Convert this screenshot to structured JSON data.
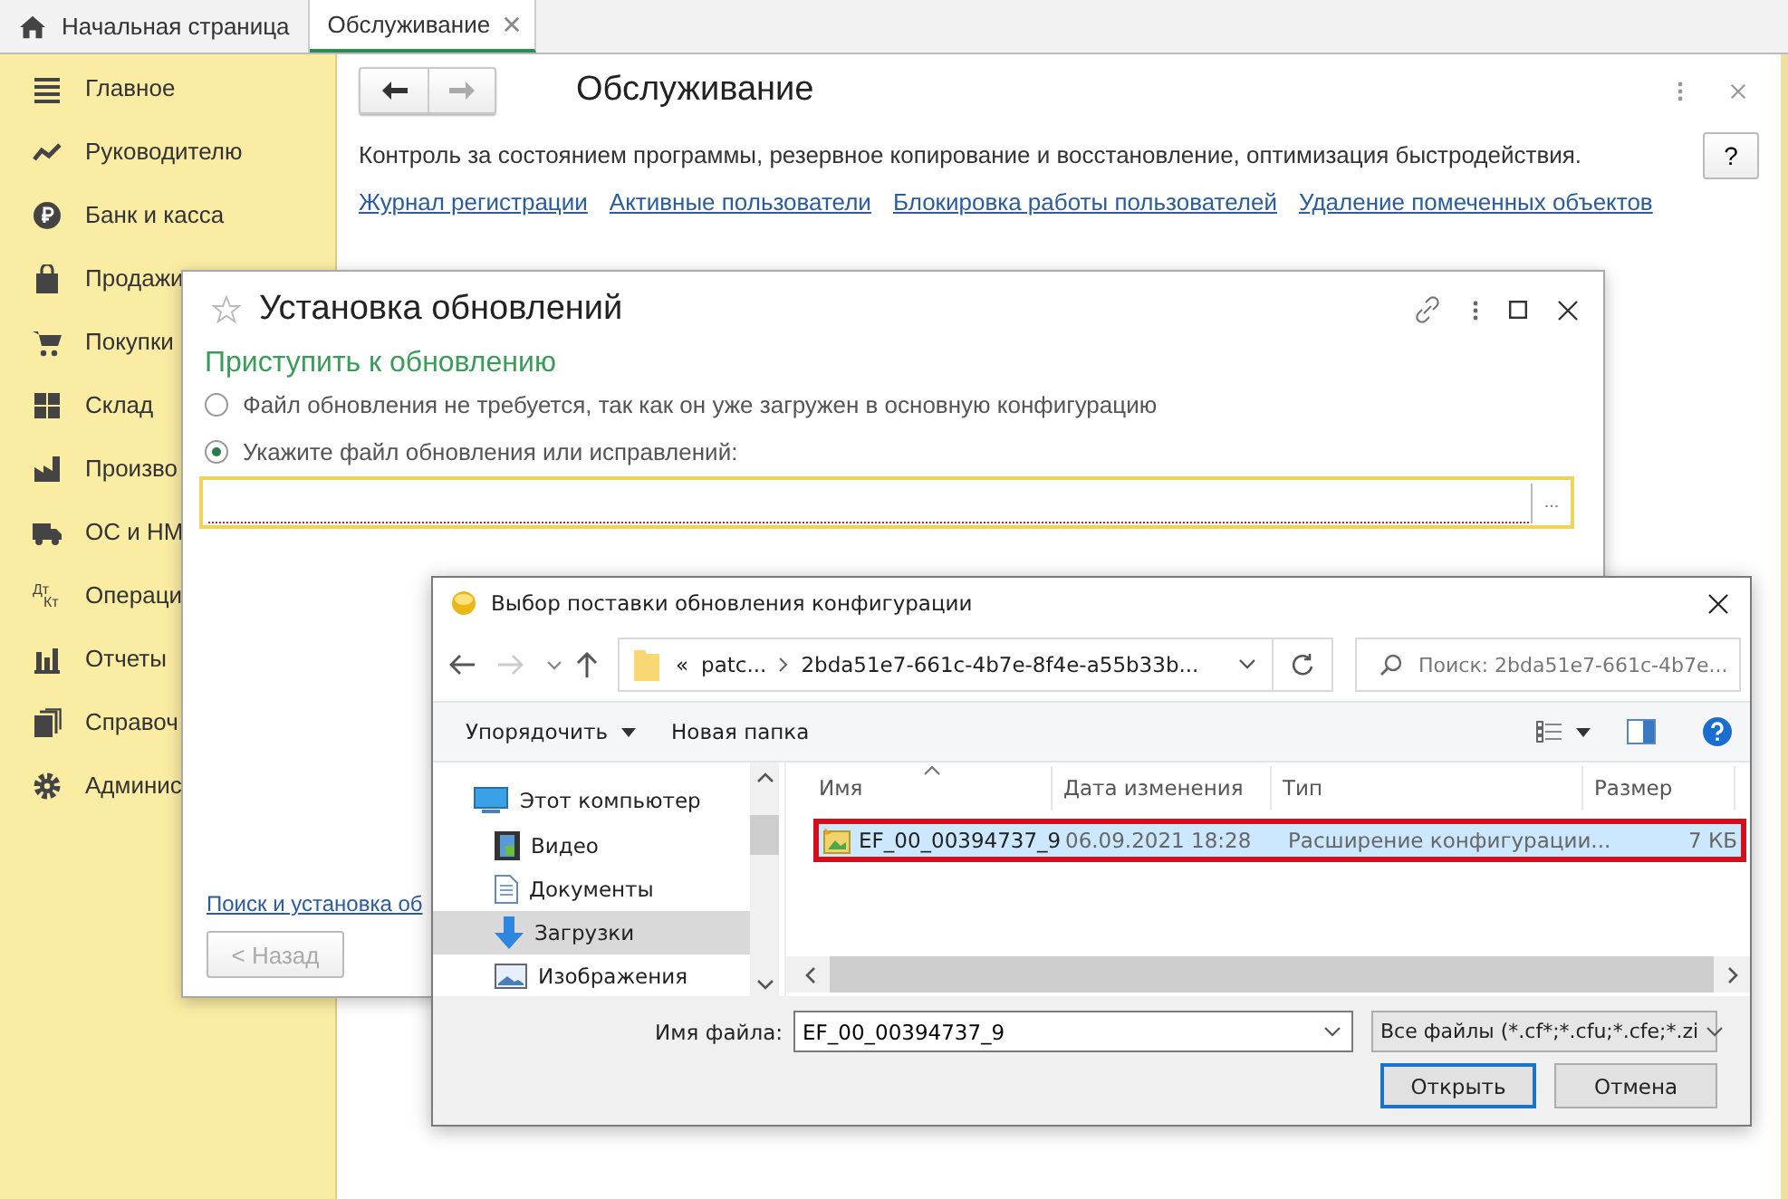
{
  "tabs": [
    {
      "label": "Начальная страница",
      "kind": "home",
      "selected": false
    },
    {
      "label": "Обслуживание",
      "kind": "closable",
      "selected": true
    }
  ],
  "sidebar": {
    "items": [
      {
        "label": "Главное",
        "kind": "menu"
      },
      {
        "label": "Руководителю",
        "kind": "trend"
      },
      {
        "label": "Банк и касса",
        "kind": "ruble"
      },
      {
        "label": "Продажи",
        "kind": "bag"
      },
      {
        "label": "Покупки",
        "kind": "cart"
      },
      {
        "label": "Склад",
        "kind": "grid"
      },
      {
        "label": "Произво",
        "kind": "factory"
      },
      {
        "label": "ОС и НМ",
        "kind": "truck"
      },
      {
        "label": "Операци",
        "kind": "letters",
        "icon_letters": [
          "Дт",
          "Кт"
        ]
      },
      {
        "label": "Отчеты",
        "kind": "bars"
      },
      {
        "label": "Справоч",
        "kind": "copies"
      },
      {
        "label": "Админис",
        "kind": "gear"
      }
    ]
  },
  "page": {
    "title": "Обслуживание",
    "description": "Контроль за состоянием программы, резервное копирование и восстановление, оптимизация быстродействия.",
    "help_button": "?",
    "links": [
      "Журнал регистрации",
      "Активные пользователи",
      "Блокировка работы пользователей",
      "Удаление помеченных объектов"
    ]
  },
  "update_dialog": {
    "title": "Установка обновлений",
    "heading": "Приступить к обновлению",
    "options": [
      {
        "label": "Файл обновления не требуется, так как он уже загружен в основную конфигурацию",
        "selected": false
      },
      {
        "label": "Укажите файл обновления или исправлений:",
        "selected": true
      }
    ],
    "choose_button": "...",
    "search_link": "Поиск и установка об",
    "back_button": {
      "label": "< Назад",
      "disabled": true
    }
  },
  "file_dialog": {
    "title": "Выбор поставки обновления конфигурации",
    "address": {
      "overflow_mark": "«",
      "segments": [
        "patc...",
        "2bda51e7-661c-4b7e-8f4e-a55b33b..."
      ]
    },
    "search": {
      "placeholder": "Поиск: 2bda51e7-661c-4b7e..."
    },
    "toolbar": [
      {
        "label": "Упорядочить",
        "dropdown": true
      },
      {
        "label": "Новая папка",
        "dropdown": false
      }
    ],
    "nav_items": [
      {
        "label": "Этот компьютер",
        "kind": "computer",
        "selected": false
      },
      {
        "label": "Видео",
        "kind": "video",
        "selected": false
      },
      {
        "label": "Документы",
        "kind": "documents",
        "selected": false
      },
      {
        "label": "Загрузки",
        "kind": "downloads",
        "selected": true
      },
      {
        "label": "Изображения",
        "kind": "pictures",
        "selected": false
      }
    ],
    "columns": [
      "Имя",
      "Дата изменения",
      "Тип",
      "Размер"
    ],
    "rows": [
      {
        "cells": [
          "EF_00_00394737_9",
          "06.09.2021 18:28",
          "Расширение конфигурации...",
          "7 КБ"
        ],
        "selected": true
      }
    ],
    "file_name": {
      "label": "Имя файла:",
      "value": "EF_00_00394737_9"
    },
    "filter": {
      "value": "Все файлы (*.cf*;*.cfu;*.cfe;*.zi"
    },
    "buttons": [
      {
        "label": "Открыть",
        "default": true
      },
      {
        "label": "Отмена",
        "default": false
      }
    ]
  }
}
